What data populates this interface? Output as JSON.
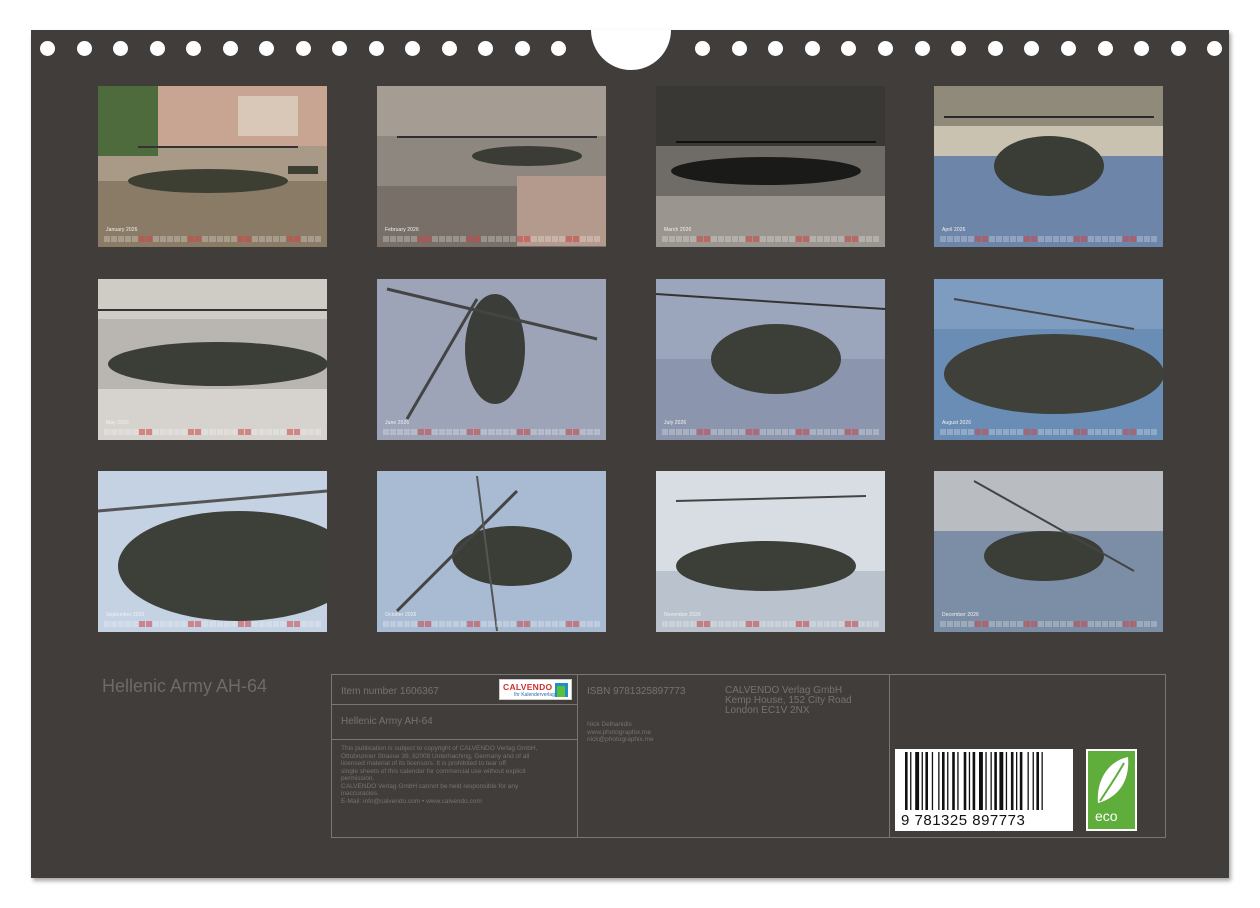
{
  "subtitle": "Hellenic Army AH-64",
  "months": [
    {
      "label": "January 2026"
    },
    {
      "label": "February 2026"
    },
    {
      "label": "March 2026"
    },
    {
      "label": "April 2026"
    },
    {
      "label": "May 2026"
    },
    {
      "label": "June 2026"
    },
    {
      "label": "July 2026"
    },
    {
      "label": "August 2026"
    },
    {
      "label": "September 2026"
    },
    {
      "label": "October 2026"
    },
    {
      "label": "November 2026"
    },
    {
      "label": "December 2026"
    }
  ],
  "info": {
    "item_number": "Item number 1606367",
    "title": "Hellenic Army AH-64",
    "copyright": [
      "This publication is subject to copyright of CALVENDO Verlag GmbH,",
      "Ottobrunner Strasse 39, 82008 Unterhaching, Germany and of all",
      "licensed material of its licensors. It is prohibited to tear off",
      "single sheets of this calendar for commercial use without explicit",
      "permission.",
      "CALVENDO Verlag GmbH cannot be held responsible for any",
      "inaccuracies.",
      "E-Mail: info@calvendo.com • www.calvendo.com"
    ],
    "isbn": "ISBN 9781325897773",
    "publisher": [
      "CALVENDO Verlag GmbH",
      "Kemp House, 152 City Road",
      "London EC1V 2NX"
    ],
    "author": [
      "Nick Delhanidis",
      "www.photographix.me",
      "nick@photographix.me"
    ],
    "barcode_number": "9 781325 897773",
    "eco_label": "eco"
  },
  "logo": {
    "brand": "CALVENDO",
    "tagline": "Ihr Kalenderverlag"
  },
  "colors": {
    "background": "#403d3a",
    "text_muted": "#77736f",
    "eco_green": "#5fad3b"
  }
}
